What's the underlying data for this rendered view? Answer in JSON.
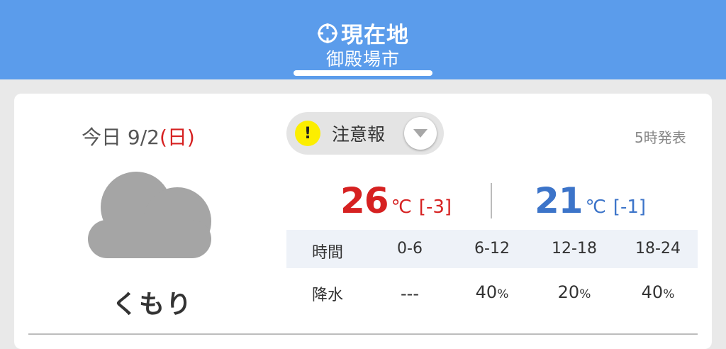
{
  "header": {
    "location_label": "現在地",
    "city": "御殿場市"
  },
  "today": {
    "prefix": "今日",
    "date": "9/2",
    "weekday": "(日)",
    "condition": "くもり",
    "icon": "cloud-icon"
  },
  "alert": {
    "label": "注意報",
    "badge": "!"
  },
  "issued": "5時発表",
  "temps": {
    "high": "26",
    "high_diff": "[-3]",
    "low": "21",
    "low_diff": "[-1]",
    "unit": "℃"
  },
  "table": {
    "header_label": "時間",
    "periods": [
      "0-6",
      "6-12",
      "12-18",
      "18-24"
    ],
    "row_label": "降水",
    "values": [
      "---",
      "40",
      "20",
      "40"
    ],
    "pct": "%"
  },
  "colors": {
    "header_bg": "#5b9ceb",
    "high": "#d62121",
    "low": "#3c74c9",
    "alert_badge": "#fcee00"
  }
}
